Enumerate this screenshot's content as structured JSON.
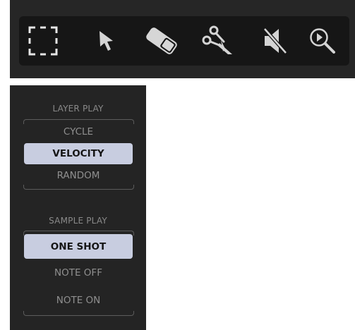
{
  "toolbar": {
    "tools": [
      {
        "name": "marquee-select-icon"
      },
      {
        "name": "pointer-arrow-icon"
      },
      {
        "name": "eraser-icon"
      },
      {
        "name": "scissors-icon"
      },
      {
        "name": "mute-speaker-icon"
      },
      {
        "name": "audition-zoom-icon"
      }
    ],
    "colors": {
      "icon": "#d0d0d0",
      "bg": "#161616",
      "frame": "#262626"
    }
  },
  "layer_play": {
    "label": "LAYER PLAY",
    "options": [
      {
        "label": "CYCLE",
        "selected": false
      },
      {
        "label": "VELOCITY",
        "selected": true
      },
      {
        "label": "RANDOM",
        "selected": false
      }
    ]
  },
  "sample_play": {
    "label": "SAMPLE PLAY",
    "options": [
      {
        "label": "ONE SHOT",
        "selected": true
      },
      {
        "label": "NOTE OFF",
        "selected": false
      },
      {
        "label": "NOTE ON",
        "selected": false
      }
    ]
  },
  "colors": {
    "selected_bg": "#c8cde0",
    "panel_bg": "#242424",
    "text": "#8f8f8f"
  }
}
